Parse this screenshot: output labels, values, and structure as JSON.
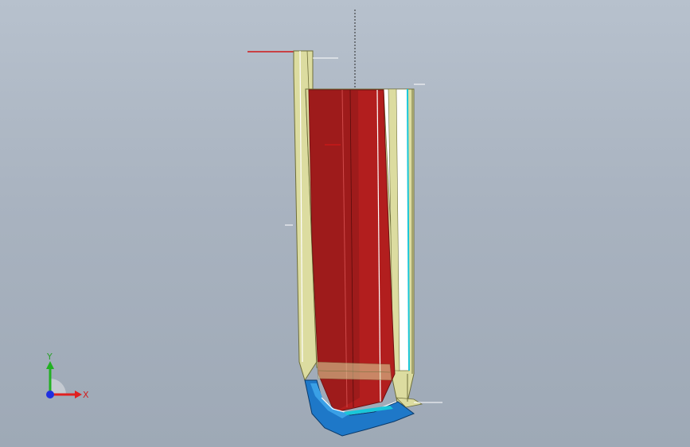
{
  "viewport": {
    "background_top": "#b7c1cd",
    "background_bottom": "#9ea9b6"
  },
  "model": {
    "colors": {
      "outer_shell": "#dcdca0",
      "shell_edge": "#6e6e3a",
      "red_face": "#b21e1e",
      "red_face_dark": "#8e1a1a",
      "blue_face": "#1e78c8",
      "blue_face_light": "#3aa0e6",
      "highlight": "#ffffff",
      "accent_cyan": "#19c7d9",
      "sketch_line": "#d01818"
    }
  },
  "triad": {
    "x_label": "X",
    "y_label": "Y",
    "x_color": "#e02020",
    "y_color": "#22b022",
    "z_color": "#1f2fe0"
  }
}
